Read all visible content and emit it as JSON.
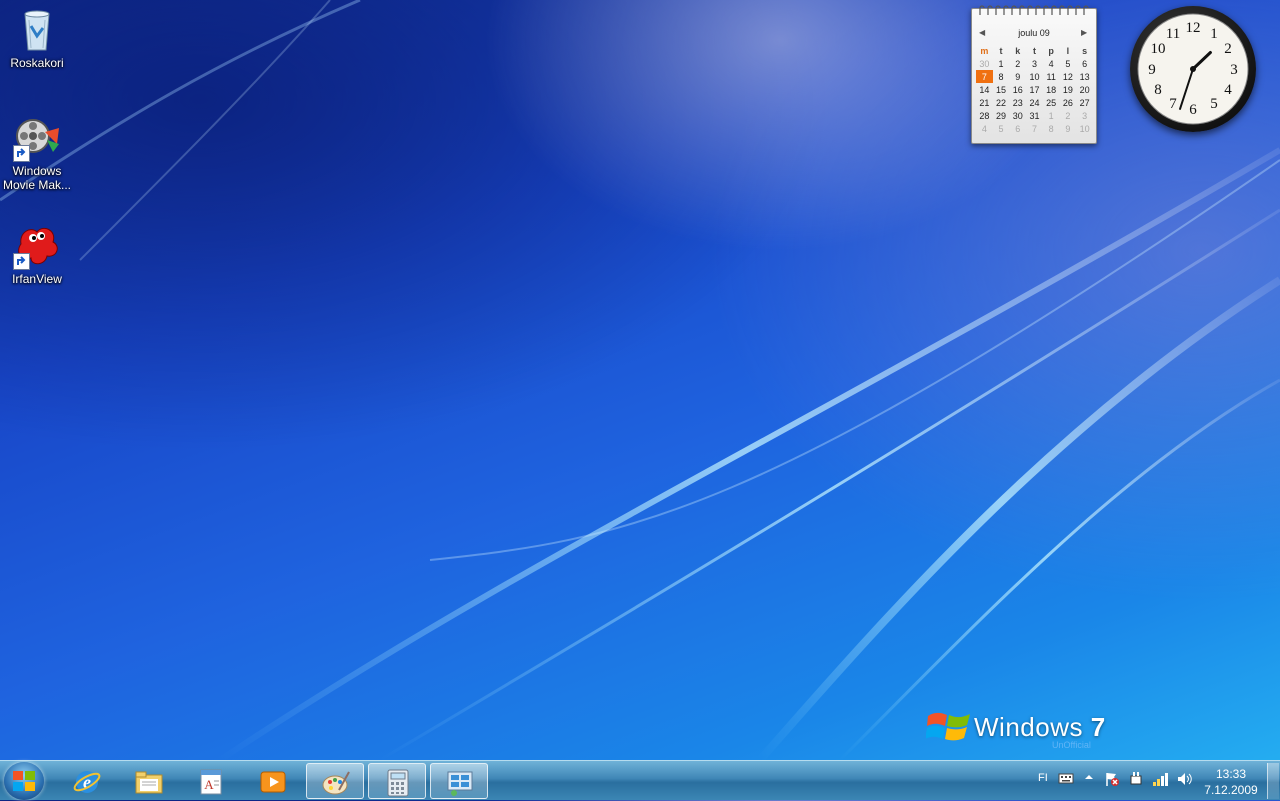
{
  "desktop": {
    "icons": [
      {
        "label": "Roskakori",
        "icon": "recycle-bin-icon"
      },
      {
        "label": "Windows\nMovie Mak...",
        "icon": "movie-maker-icon"
      },
      {
        "label": "IrfanView",
        "icon": "irfanview-icon"
      }
    ],
    "logo": {
      "word": "Windows",
      "version": "7",
      "sub": "UnOfficial"
    }
  },
  "calendar": {
    "month_label": "joulu 09",
    "weekdays": [
      "m",
      "t",
      "k",
      "t",
      "p",
      "l",
      "s"
    ],
    "weeks": [
      [
        "30",
        "1",
        "2",
        "3",
        "4",
        "5",
        "6"
      ],
      [
        "7",
        "8",
        "9",
        "10",
        "11",
        "12",
        "13"
      ],
      [
        "14",
        "15",
        "16",
        "17",
        "18",
        "19",
        "20"
      ],
      [
        "21",
        "22",
        "23",
        "24",
        "25",
        "26",
        "27"
      ],
      [
        "28",
        "29",
        "30",
        "31",
        "1",
        "2",
        "3"
      ],
      [
        "4",
        "5",
        "6",
        "7",
        "8",
        "9",
        "10"
      ]
    ],
    "today": "7"
  },
  "clock_gadget": {
    "numbers": [
      "12",
      "1",
      "2",
      "3",
      "4",
      "5",
      "6",
      "7",
      "8",
      "9",
      "10",
      "11"
    ],
    "time": "13:33"
  },
  "taskbar": {
    "pinned": [
      {
        "icon": "internet-explorer-icon"
      },
      {
        "icon": "windows-explorer-icon"
      },
      {
        "icon": "wordpad-icon"
      },
      {
        "icon": "media-player-icon"
      },
      {
        "icon": "paint-icon"
      },
      {
        "icon": "calculator-icon"
      },
      {
        "icon": "control-panel-icon"
      }
    ],
    "tray": {
      "language": "FI",
      "time": "13:33",
      "date": "7.12.2009"
    }
  },
  "colors": {
    "accent": "#f07010",
    "taskbar": "#3f86b6"
  }
}
